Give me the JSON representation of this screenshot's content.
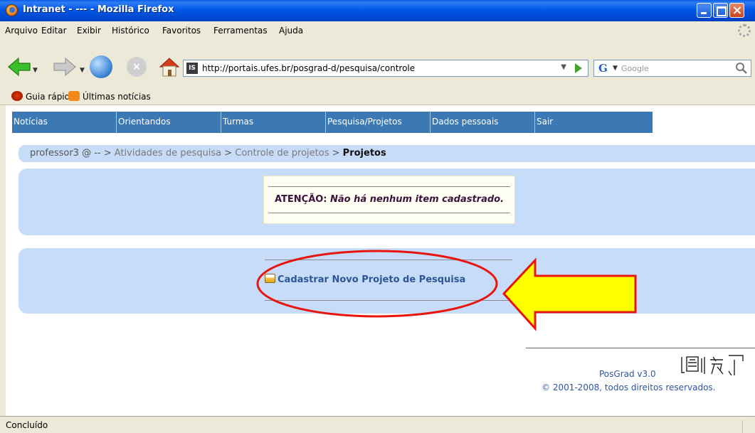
{
  "window": {
    "title": "Intranet - --- - Mozilla Firefox"
  },
  "menubar": {
    "items": [
      "Arquivo",
      "Editar",
      "Exibir",
      "Histórico",
      "Favoritos",
      "Ferramentas",
      "Ajuda"
    ]
  },
  "toolbar": {
    "url": "http://portais.ufes.br/posgrad-d/pesquisa/controle",
    "search_engine_glyph": "G",
    "search_placeholder": "Google",
    "site_icon_text": "IS"
  },
  "bookmarks": {
    "items": [
      "Guia rápido",
      "Últimas notícias"
    ]
  },
  "nav": {
    "items": [
      "Notícias",
      "Orientandos",
      "Turmas",
      "Pesquisa/Projetos",
      "Dados pessoais",
      "Sair"
    ]
  },
  "breadcrumb": {
    "user": "professor3 @ -- >",
    "link1": "Atividades de pesquisa",
    "sep1": ">",
    "link2": "Controle de projetos",
    "sep2": ">",
    "current": "Projetos"
  },
  "alert": {
    "label": "ATENÇÃO:",
    "message": "Não há nenhum item cadastrado."
  },
  "action": {
    "new_project": "Cadastrar Novo Projeto de Pesquisa"
  },
  "footer": {
    "version": "PosGrad v3.0",
    "copyright": "© 2001-2008, todos direitos reservados."
  },
  "status": {
    "text": "Concluído"
  },
  "colors": {
    "nav_bg": "#3b78b4",
    "panel_bg": "#c7dcf8",
    "annotation_red": "#e8140d",
    "annotation_arrow": "#ffff00"
  }
}
